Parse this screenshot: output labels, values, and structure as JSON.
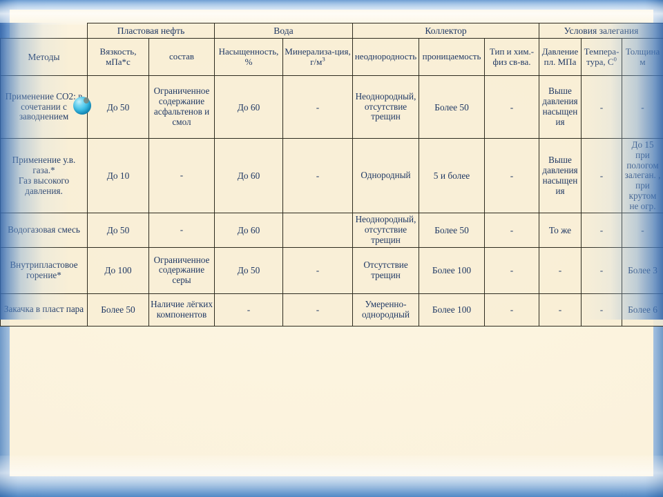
{
  "slide": {
    "background_color": "#7aaad9",
    "panel_color": "#fbf2dc",
    "accent_color": "#1f3864",
    "sphere_color": "#3fc1e8"
  },
  "table": {
    "corner_label": "Методы",
    "group_headers": [
      {
        "label": "Пластовая нефть",
        "span": 2
      },
      {
        "label": "Вода",
        "span": 2
      },
      {
        "label": "Коллектор",
        "span": 3
      },
      {
        "label": "Условия залегания",
        "span": 3
      }
    ],
    "sub_headers": [
      "Вязкость, мПа*с",
      "состав",
      "Насыщенность, %",
      "Минерализа-ция, г/м3",
      "неоднородность",
      "проницаемость",
      "Тип и хим.-физ св-ва.",
      "Давление пл. МПа",
      "Темпера-тура, С0",
      "Толщинам"
    ],
    "rows": [
      {
        "method": "Применение СО2: в сочетании с заводнением",
        "cells": [
          "До 50",
          "Ограниченное содержание асфальтенов и смол",
          "До 60",
          "-",
          "Неоднородный, отсутствие трещин",
          "Более 50",
          "-",
          "Выше давления насыщения",
          "-",
          "-"
        ]
      },
      {
        "method": "Применение у.в. газа.*\nГаз высокого давления.",
        "cells": [
          "До 10",
          "-",
          "До 60",
          "-",
          "Однородный",
          "5 и более",
          "-",
          "Выше давления насыщения",
          "-",
          "До 15 при пологом залеган. , при крутом не огр."
        ]
      },
      {
        "method": "Водогазовая смесь",
        "cells": [
          "До 50",
          "-",
          "До 60",
          "",
          "Неоднородный, отсутствие трещин",
          "Более 50",
          "-",
          "То же",
          "-",
          "-"
        ]
      },
      {
        "method": "Внутрипластовое горение*",
        "cells": [
          "До 100",
          "Ограниченное содержание серы",
          "До 50",
          "-",
          "Отсутствие трещин",
          "Более 100",
          "-",
          "-",
          "-",
          "Более 3"
        ]
      },
      {
        "method": "Закачка в пласт пара",
        "cells": [
          "Более 50",
          "Наличие лёгких компонентов",
          "-",
          "-",
          "Умеренно-однородный",
          "Более 100",
          "-",
          "-",
          "-",
          "Более 6"
        ]
      }
    ]
  }
}
